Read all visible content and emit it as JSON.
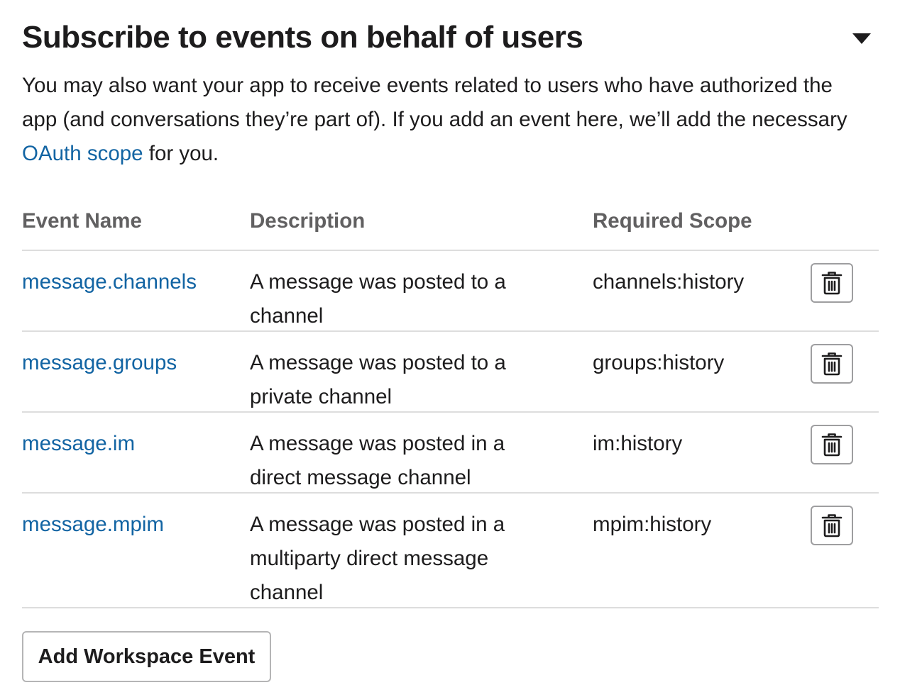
{
  "section": {
    "title": "Subscribe to events on behalf of users",
    "intro_before": "You may also want your app to receive events related to users who have authorized the app (and conversations they’re part of). If you add an event here, we’ll add the necessary ",
    "intro_link": "OAuth scope",
    "intro_after": " for you."
  },
  "table": {
    "headers": {
      "event_name": "Event Name",
      "description": "Description",
      "required_scope": "Required Scope"
    },
    "rows": [
      {
        "event_name": "message.channels",
        "description": "A message was posted to a channel",
        "required_scope": "channels:history"
      },
      {
        "event_name": "message.groups",
        "description": "A message was posted to a private channel",
        "required_scope": "groups:history"
      },
      {
        "event_name": "message.im",
        "description": "A message was posted in a direct message channel",
        "required_scope": "im:history"
      },
      {
        "event_name": "message.mpim",
        "description": "A message was posted in a multiparty direct message channel",
        "required_scope": "mpim:history"
      }
    ]
  },
  "actions": {
    "add_label": "Add Workspace Event"
  },
  "colors": {
    "link": "#1264a3",
    "text": "#1d1c1d",
    "header_text": "#616061",
    "divider": "#dddddd"
  },
  "icons": {
    "collapse": "caret-down-icon",
    "delete": "trash-icon"
  }
}
